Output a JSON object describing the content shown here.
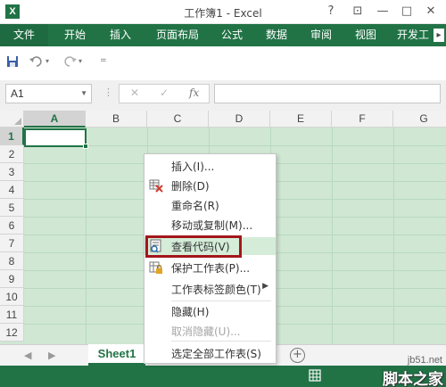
{
  "window": {
    "title": "工作簿1 - Excel",
    "app_icon_letter": "X",
    "help_label": "?",
    "ribbon_display_label": "⊡",
    "minimize_label": "—",
    "restore_label": "□",
    "close_label": "✕"
  },
  "ribbon": {
    "tabs": [
      {
        "label": "文件"
      },
      {
        "label": "开始"
      },
      {
        "label": "插入"
      },
      {
        "label": "页面布局"
      },
      {
        "label": "公式"
      },
      {
        "label": "数据"
      },
      {
        "label": "审阅"
      },
      {
        "label": "视图"
      },
      {
        "label": "开发工"
      }
    ],
    "scroll_label": "▸"
  },
  "formula_bar": {
    "name_box_value": "A1",
    "cancel_label": "✕",
    "enter_label": "✓",
    "function_label": "fx",
    "formula_value": ""
  },
  "grid": {
    "columns": [
      "A",
      "B",
      "C",
      "D",
      "E",
      "F",
      "G"
    ],
    "rows": [
      "1",
      "2",
      "3",
      "4",
      "5",
      "6",
      "7",
      "8",
      "9",
      "10",
      "11",
      "12"
    ],
    "active_cell": "A1"
  },
  "context_menu": {
    "items": [
      {
        "label": "插入(I)...",
        "icon": "",
        "state": "normal"
      },
      {
        "label": "删除(D)",
        "icon": "delete-sheet-icon",
        "state": "normal"
      },
      {
        "label": "重命名(R)",
        "icon": "",
        "state": "normal"
      },
      {
        "label": "移动或复制(M)...",
        "icon": "",
        "state": "normal"
      },
      {
        "label": "查看代码(V)",
        "icon": "view-code-icon",
        "state": "hover"
      },
      {
        "label": "保护工作表(P)...",
        "icon": "protect-sheet-icon",
        "state": "normal"
      },
      {
        "label": "工作表标签颜色(T)",
        "icon": "",
        "state": "normal",
        "submenu": true
      },
      {
        "label": "隐藏(H)",
        "icon": "",
        "state": "normal"
      },
      {
        "label": "取消隐藏(U)...",
        "icon": "",
        "state": "disabled"
      },
      {
        "label": "选定全部工作表(S)",
        "icon": "",
        "state": "normal"
      }
    ],
    "submenu_arrow": "▶"
  },
  "sheet_tabs": {
    "tabs": [
      "Sheet1"
    ],
    "add_label": "+",
    "prev_label": "◀",
    "next_label": "▶"
  },
  "status_bar": {
    "icons": [
      "ready-icon",
      "normal-view-icon",
      "page-layout-icon"
    ]
  },
  "watermark": {
    "url": "jb51.net",
    "name": "脚本之家"
  },
  "colors": {
    "accent": "#217346",
    "grid_fill": "#cfe7d3",
    "menu_hover": "#d4ecd8",
    "highlight_box": "#a3161a"
  }
}
